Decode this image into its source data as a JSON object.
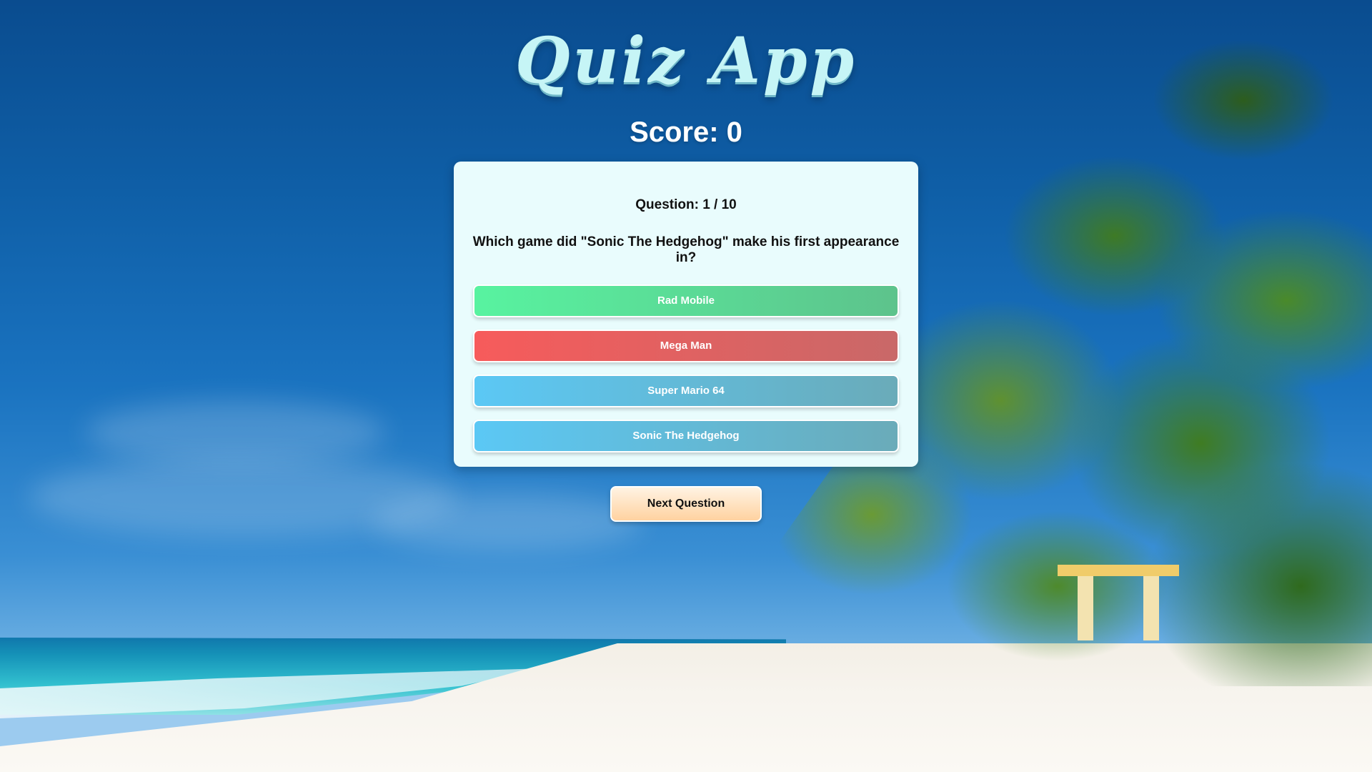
{
  "app": {
    "title": "Quiz App"
  },
  "score": {
    "label": "Score: 0"
  },
  "question": {
    "counter": "Question: 1 / 10",
    "text": "Which game did \"Sonic The Hedgehog\" make his first appearance in?"
  },
  "answers": [
    {
      "label": "Rad Mobile",
      "state": "correct"
    },
    {
      "label": "Mega Man",
      "state": "wrong"
    },
    {
      "label": "Super Mario 64",
      "state": "neutral"
    },
    {
      "label": "Sonic The Hedgehog",
      "state": "neutral"
    }
  ],
  "controls": {
    "next_label": "Next Question"
  },
  "colors": {
    "correct": "#58f3a0",
    "wrong": "#f75b5b",
    "neutral": "#5bc8f5",
    "card_bg": "#e9fcfd",
    "next_button": "#ffd2a0"
  }
}
